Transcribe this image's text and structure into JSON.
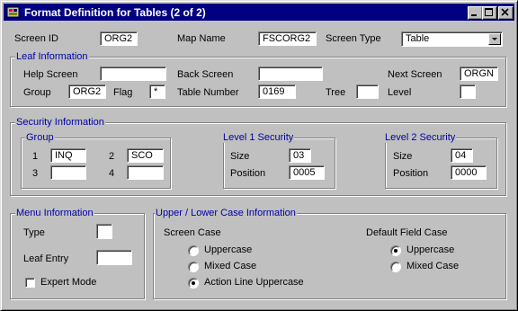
{
  "window": {
    "title": "Format Definition for Tables (2 of 2)"
  },
  "top": {
    "screen_id_label": "Screen ID",
    "screen_id": "ORG2",
    "map_name_label": "Map Name",
    "map_name": "FSCORG2",
    "screen_type_label": "Screen Type",
    "screen_type": "Table"
  },
  "leaf": {
    "title": "Leaf Information",
    "help_label": "Help Screen",
    "help": "",
    "back_label": "Back Screen",
    "back": "",
    "next_label": "Next Screen",
    "next": "ORGN",
    "group_label": "Group",
    "group": "ORG2",
    "flag_label": "Flag",
    "flag": "*",
    "table_number_label": "Table Number",
    "table_number": "0169",
    "tree_label": "Tree",
    "tree": "",
    "level_label": "Level",
    "level": ""
  },
  "security": {
    "title": "Security Information",
    "group_title": "Group",
    "g1_label": "1",
    "g1": "INQ",
    "g2_label": "2",
    "g2": "SCO",
    "g3_label": "3",
    "g3": "",
    "g4_label": "4",
    "g4": "",
    "level1": {
      "title": "Level 1 Security",
      "size_label": "Size",
      "size": "03",
      "position_label": "Position",
      "position": "0005"
    },
    "level2": {
      "title": "Level 2 Security",
      "size_label": "Size",
      "size": "04",
      "position_label": "Position",
      "position": "0000"
    }
  },
  "menu": {
    "title": "Menu Information",
    "type_label": "Type",
    "type": "",
    "leaf_entry_label": "Leaf Entry",
    "leaf_entry": "",
    "expert_mode_label": "Expert Mode",
    "expert_mode": false
  },
  "case": {
    "title": "Upper / Lower Case Information",
    "screen_case_label": "Screen Case",
    "screen_options": [
      "Uppercase",
      "Mixed Case",
      "Action Line Uppercase"
    ],
    "screen_selected": "Action Line Uppercase",
    "field_case_label": "Default Field Case",
    "field_options": [
      "Uppercase",
      "Mixed Case"
    ],
    "field_selected": "Uppercase"
  }
}
